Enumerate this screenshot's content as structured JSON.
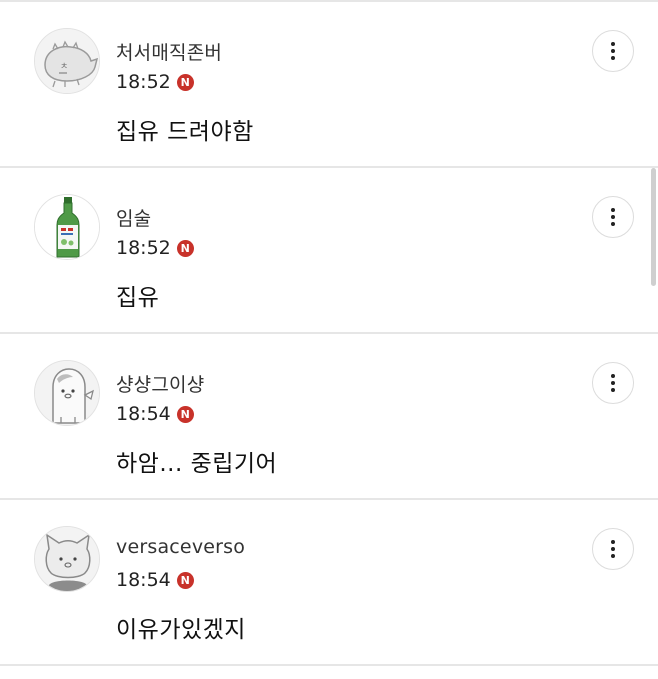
{
  "comments": [
    {
      "nickname": "처서매직존버",
      "time": "18:52",
      "badge": "N",
      "text": "집유 드려야함",
      "avatar_icon": "sea-creature-doodle-icon"
    },
    {
      "nickname": "임술",
      "time": "18:52",
      "badge": "N",
      "text": "집유",
      "avatar_icon": "soju-bottle-icon"
    },
    {
      "nickname": "샹샹그이샹",
      "time": "18:54",
      "badge": "N",
      "text": "하암... 중립기어",
      "avatar_icon": "ghost-character-icon"
    },
    {
      "nickname": "versaceverso",
      "time": "18:54",
      "badge": "N",
      "text": "이유가있겠지",
      "avatar_icon": "cat-face-icon"
    }
  ],
  "colors": {
    "badge": "#c8322a",
    "divider": "#e6e6e6",
    "bottle_green": "#3f8f3a"
  }
}
